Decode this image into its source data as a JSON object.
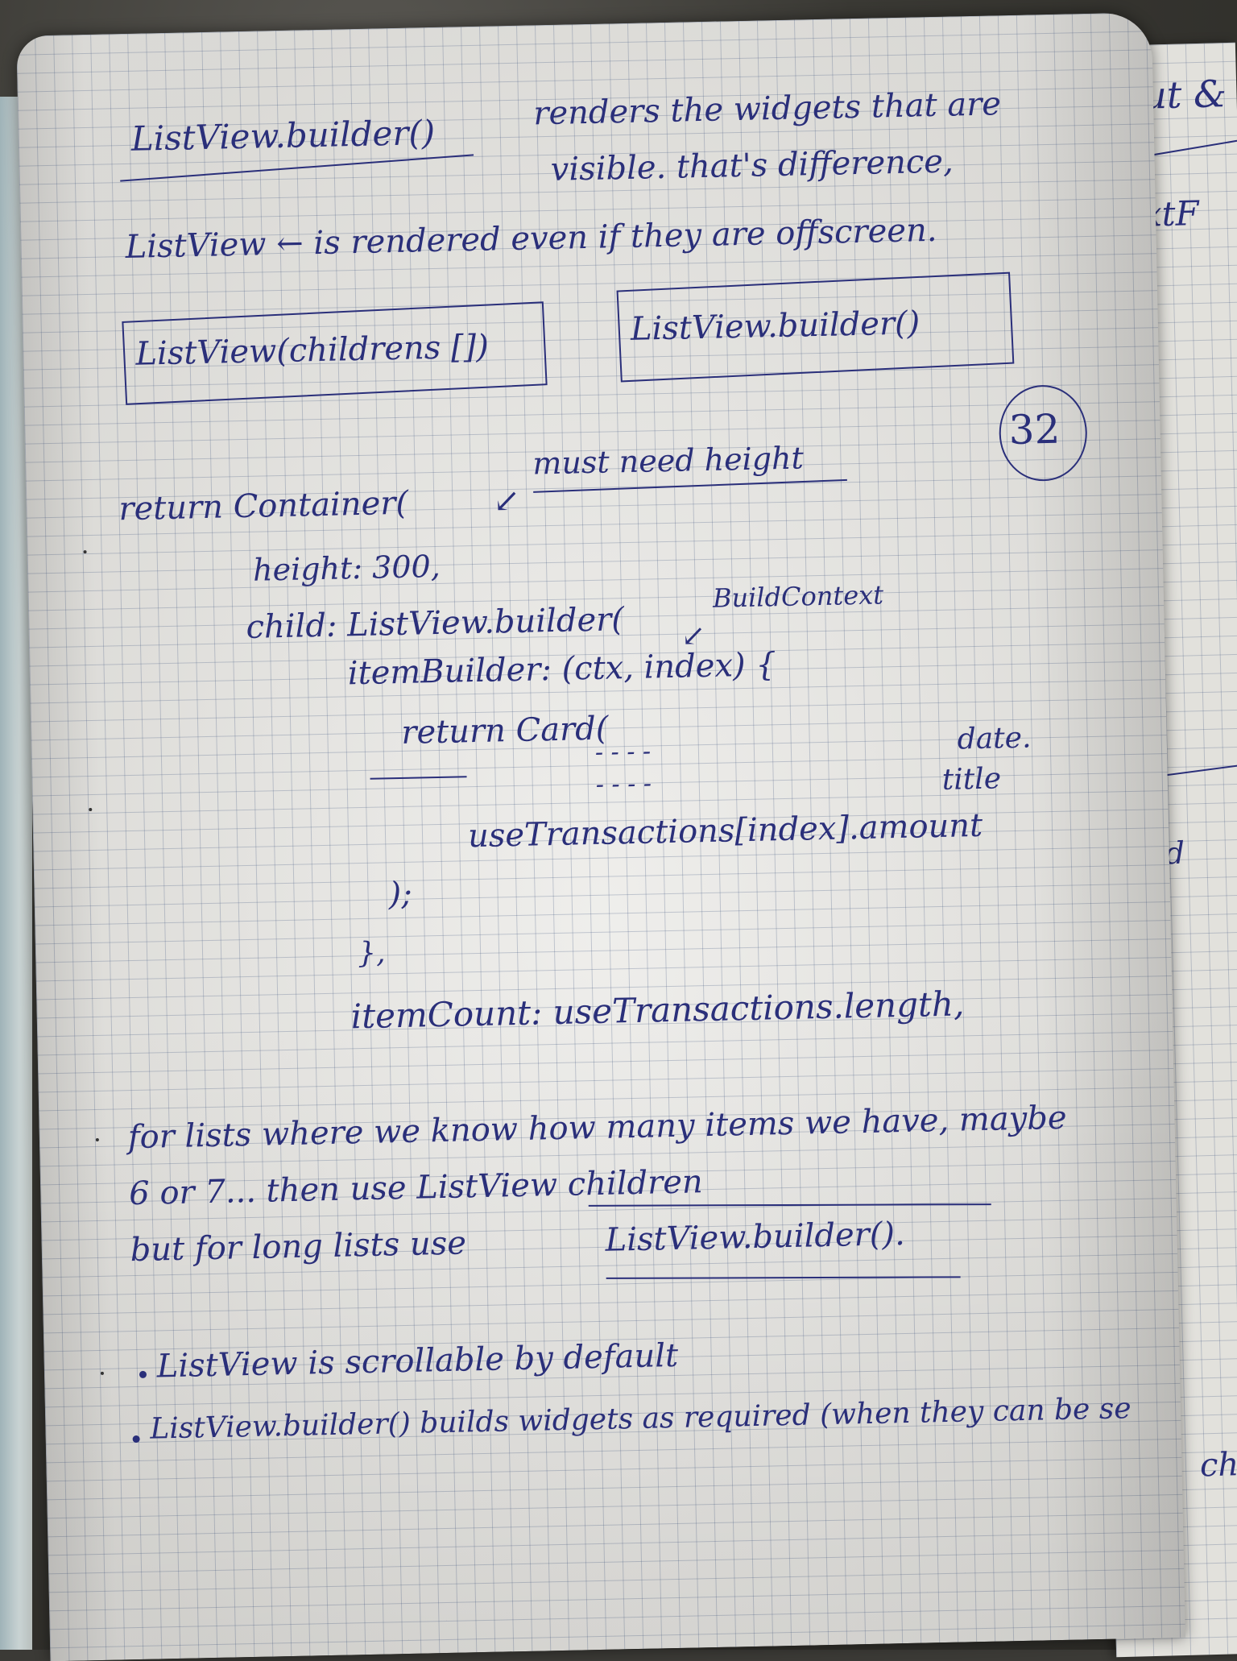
{
  "notes": {
    "line1_left": "ListView.builder()",
    "line1_right": "renders the widgets that are",
    "line2": "visible. that's difference,",
    "line3": "ListView ← is rendered even if they are offscreen.",
    "box_left": "ListView(childrens [])",
    "box_right": "ListView.builder()",
    "page_number": "32",
    "code_return": "return Container(",
    "code_note": "must need height",
    "code_height": "height: 300,",
    "code_child": "child: ListView.builder(",
    "code_buildcontext": "BuildContext",
    "code_itembuilder": "itemBuilder: (ctx, index) {",
    "code_return_card": "return Card(",
    "code_dash1": "- - - -",
    "code_dash2": "- - - -",
    "code_date": "date.",
    "code_title": "title",
    "code_transactions": "useTransactions[index].amount",
    "code_close1": ");",
    "code_close2": "},",
    "code_itemcount": "itemCount: useTransactions.length,",
    "para1": "for lists where we know how many items we have, maybe",
    "para2": "6 or 7... then use ListView children",
    "para3_a": "but for long lists use",
    "para3_b": "ListView.builder().",
    "bullet1": "ListView is scrollable by default",
    "bullet2": "ListView.builder() builds widgets as required (when they can be se"
  },
  "right_page": {
    "r1": "input &",
    "r2": "TextF",
    "r3": "void",
    "r4": "chil"
  },
  "colors": {
    "ink": "#2a2f7a",
    "paper": "#e6e5e1",
    "grid": "#7080a8"
  }
}
